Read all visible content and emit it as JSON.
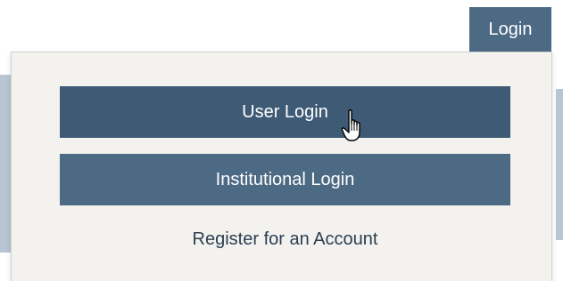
{
  "header": {
    "login_label": "Login"
  },
  "dropdown": {
    "user_login_label": "User Login",
    "institutional_login_label": "Institutional Login",
    "register_label": "Register for an Account"
  },
  "cursor": {
    "icon": "hand-pointer-icon"
  },
  "colors": {
    "button_primary": "#4d6a85",
    "button_hover": "#3e5a75",
    "dropdown_bg": "#f3f2ef",
    "link_text": "#2c3e50"
  }
}
